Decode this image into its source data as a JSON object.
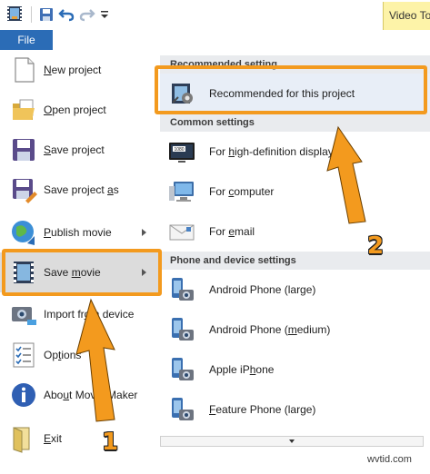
{
  "toolbar": {
    "items": [
      {
        "icon": "film-icon"
      },
      {
        "icon": "save-icon"
      },
      {
        "icon": "undo-icon"
      },
      {
        "icon": "redo-icon"
      },
      {
        "icon": "customize-dropdown-icon"
      }
    ],
    "context_tab": "Video To"
  },
  "file_tab": "File",
  "left_menu": [
    {
      "label": "New project",
      "icon": "new-project-icon"
    },
    {
      "label": "Open project",
      "icon": "open-project-icon"
    },
    {
      "label": "Save project",
      "icon": "save-project-icon"
    },
    {
      "label": "Save project as",
      "icon": "save-project-as-icon"
    },
    {
      "label": "Publish movie",
      "icon": "publish-movie-icon",
      "has_submenu": true
    },
    {
      "label": "Save movie",
      "icon": "save-movie-icon",
      "has_submenu": true,
      "selected": true
    },
    {
      "label": "Import from device",
      "icon": "import-device-icon"
    },
    {
      "label": "Options",
      "icon": "options-icon"
    },
    {
      "label": "About Movie Maker",
      "icon": "about-icon"
    },
    {
      "label": "Exit",
      "icon": "exit-icon"
    }
  ],
  "submenu": {
    "sections": [
      {
        "header": "Recommended setting",
        "items": [
          {
            "label": "Recommended for this project",
            "icon": "recommended-settings-icon"
          }
        ]
      },
      {
        "header": "Common settings",
        "items": [
          {
            "label": "For high-definition display",
            "icon": "hd-display-icon"
          },
          {
            "label": "For computer",
            "icon": "computer-icon"
          },
          {
            "label": "For email",
            "icon": "email-icon"
          }
        ]
      },
      {
        "header": "Phone and device settings",
        "items": [
          {
            "label": "Android Phone (large)",
            "icon": "phone-icon"
          },
          {
            "label": "Android Phone (medium)",
            "icon": "phone-icon"
          },
          {
            "label": "Apple iPhone",
            "icon": "phone-icon"
          },
          {
            "label": "Feature Phone (large)",
            "icon": "phone-icon"
          }
        ]
      }
    ]
  },
  "annotations": {
    "step1": "1",
    "step2": "2",
    "highlight_color": "#f39a1e"
  },
  "watermark": "wvtid.com"
}
